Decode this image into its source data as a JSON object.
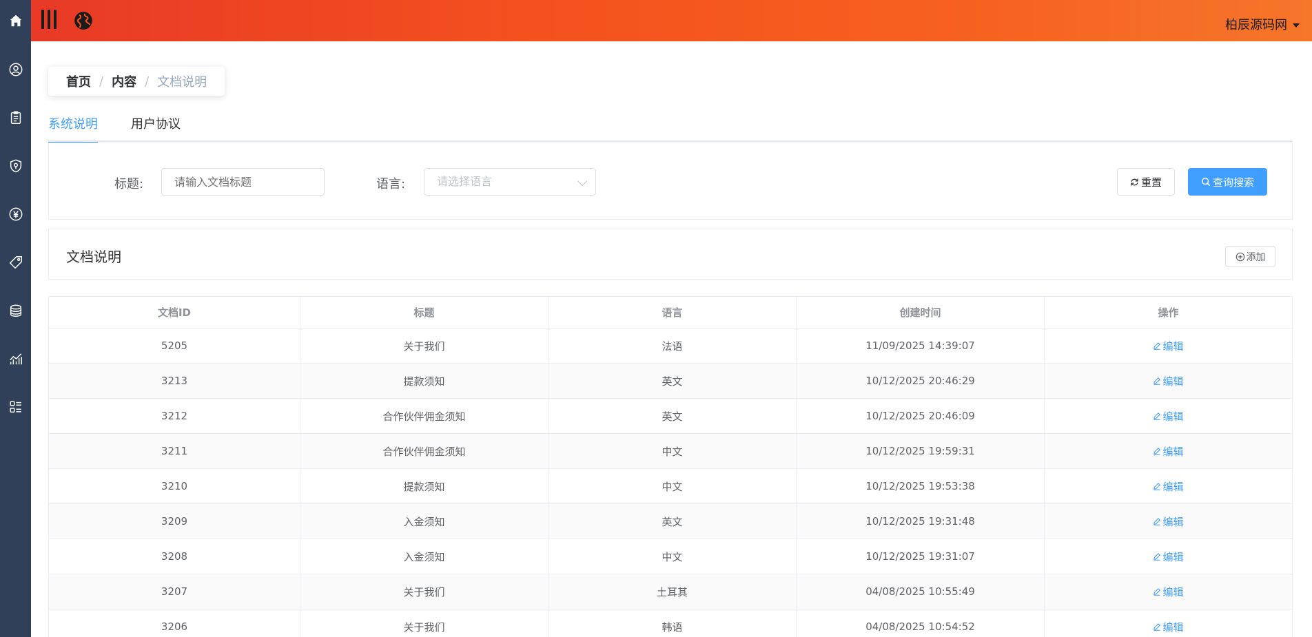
{
  "header": {
    "username": "柏辰源码网"
  },
  "sidebar": {
    "icons": [
      "home-icon",
      "user-circle-icon",
      "clipboard-icon",
      "shield-icon",
      "yen-icon",
      "tag-icon",
      "coins-icon",
      "chart-icon",
      "list-icon"
    ]
  },
  "breadcrumb": {
    "items": [
      "首页",
      "内容"
    ],
    "current": "文档说明",
    "separator": "/"
  },
  "tabs": [
    {
      "label": "系统说明",
      "active": true
    },
    {
      "label": "用户协议",
      "active": false
    }
  ],
  "filter": {
    "title_label": "标题:",
    "title_placeholder": "请输入文档标题",
    "language_label": "语言:",
    "language_placeholder": "请选择语言",
    "reset_label": "重置",
    "search_label": "查询搜索"
  },
  "section": {
    "title": "文档说明",
    "add_label": "添加"
  },
  "table": {
    "columns": [
      "文档ID",
      "标题",
      "语言",
      "创建时间",
      "操作"
    ],
    "edit_label": "编辑",
    "rows": [
      {
        "id": "5205",
        "title": "关于我们",
        "lang": "法语",
        "created": "11/09/2025 14:39:07"
      },
      {
        "id": "3213",
        "title": "提款须知",
        "lang": "英文",
        "created": "10/12/2025 20:46:29"
      },
      {
        "id": "3212",
        "title": "合作伙伴佣金须知",
        "lang": "英文",
        "created": "10/12/2025 20:46:09"
      },
      {
        "id": "3211",
        "title": "合作伙伴佣金须知",
        "lang": "中文",
        "created": "10/12/2025 19:59:31"
      },
      {
        "id": "3210",
        "title": "提款须知",
        "lang": "中文",
        "created": "10/12/2025 19:53:38"
      },
      {
        "id": "3209",
        "title": "入金须知",
        "lang": "英文",
        "created": "10/12/2025 19:31:48"
      },
      {
        "id": "3208",
        "title": "入金须知",
        "lang": "中文",
        "created": "10/12/2025 19:31:07"
      },
      {
        "id": "3207",
        "title": "关于我们",
        "lang": "土耳其",
        "created": "04/08/2025 10:55:49"
      },
      {
        "id": "3206",
        "title": "关于我们",
        "lang": "韩语",
        "created": "04/08/2025 10:54:52"
      }
    ]
  },
  "colors": {
    "sidebar_bg": "#2f4058",
    "header_gradient_start": "#e83a26",
    "header_gradient_end": "#f6762a",
    "accent": "#409eff"
  }
}
